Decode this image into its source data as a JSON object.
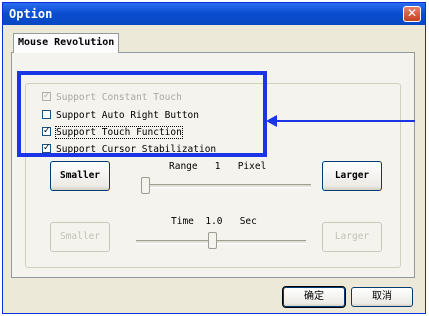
{
  "window": {
    "title": "Option",
    "close_glyph": "✕"
  },
  "tab": {
    "label": "Mouse Revolution"
  },
  "options": [
    {
      "label": "Support Constant Touch",
      "checked": true,
      "enabled": false,
      "glyph": "✓"
    },
    {
      "label": "Support Auto Right Button",
      "checked": false,
      "enabled": true,
      "glyph": ""
    },
    {
      "label": "Support Touch Function",
      "checked": true,
      "enabled": true,
      "glyph": "✓"
    },
    {
      "label": "Support Cursor Stabilization",
      "checked": true,
      "enabled": true,
      "glyph": "✓"
    }
  ],
  "range_slider": {
    "label": "Range",
    "value": "1",
    "unit": "Pixel",
    "smaller_label": "Smaller",
    "larger_label": "Larger",
    "level": 0.0,
    "enabled": true
  },
  "time_slider": {
    "label": "Time",
    "value": "1.0",
    "unit": "Sec",
    "smaller_label": "Smaller",
    "larger_label": "Larger",
    "level": 0.45,
    "enabled": false
  },
  "footer": {
    "ok_label": "确定",
    "cancel_label": "取消"
  },
  "colors": {
    "annotation": "#1a35e6",
    "titlebar": "#0a4ccd"
  }
}
